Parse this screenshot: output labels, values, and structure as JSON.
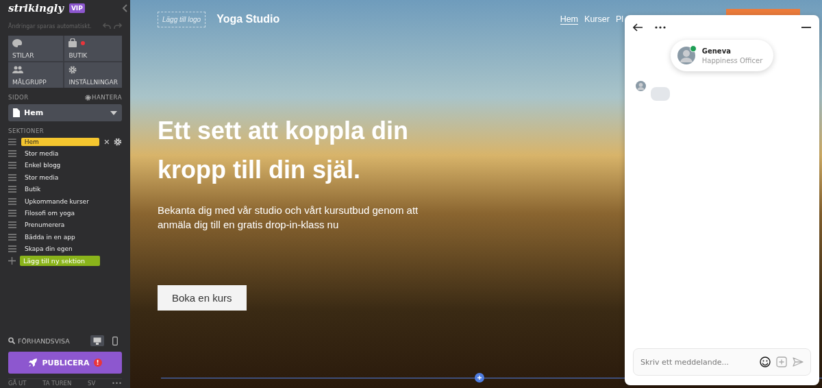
{
  "sidebar": {
    "logo": "strikingly",
    "badge": "VIP",
    "autosave": "Ändringar sparas automatiskt.",
    "tools": [
      {
        "kind": "palette",
        "label": "STILAR",
        "alert": false
      },
      {
        "kind": "bag",
        "label": "BUTIK",
        "alert": true
      },
      {
        "kind": "people",
        "label": "MÅLGRUPP",
        "alert": false
      },
      {
        "kind": "gear",
        "label": "INSTÄLLNINGAR",
        "alert": false
      }
    ],
    "pages_label": "SIDOR",
    "manage": "HANTERA",
    "page_select": "Hem",
    "sections_label": "SEKTIONER",
    "sections": [
      {
        "label": "Hem",
        "selected": true
      },
      {
        "label": "Stor media",
        "selected": false
      },
      {
        "label": "Enkel blogg",
        "selected": false
      },
      {
        "label": "Stor media",
        "selected": false
      },
      {
        "label": "Butik",
        "selected": false
      },
      {
        "label": "Upkommande kurser",
        "selected": false
      },
      {
        "label": "Filosofi om yoga",
        "selected": false
      },
      {
        "label": "Prenumerera",
        "selected": false
      },
      {
        "label": "Bädda in en app",
        "selected": false
      },
      {
        "label": "Skapa din egen",
        "selected": false
      }
    ],
    "add_section": "Lägg till ny sektion",
    "preview": "FÖRHANDSVISA",
    "devices": [
      {
        "kind": "desktop",
        "selected": true
      },
      {
        "kind": "mobile",
        "selected": false
      }
    ],
    "publish": "PUBLICERA",
    "publish_alert": "!",
    "footer": [
      "GÅ UT",
      "TA TUREN",
      "SV",
      "•••"
    ]
  },
  "site": {
    "logo_placeholder": "Lägg till logo",
    "title": "Yoga Studio",
    "nav": [
      {
        "label": "Hem",
        "selected": true
      },
      {
        "label": "Kurser",
        "selected": false
      },
      {
        "label": "Pl",
        "selected": false
      }
    ],
    "heading": "Ett sett att koppla din kropp till din själ.",
    "subheading": "Bekanta dig med vår studio och vårt kursutbud genom att anmäla dig till en gratis drop-in-klass nu",
    "button": "Boka en kurs"
  },
  "chat": {
    "agent_name": "Geneva",
    "agent_role": "Happiness Officer",
    "online": true,
    "placeholder": "Skriv ett meddelande..."
  }
}
